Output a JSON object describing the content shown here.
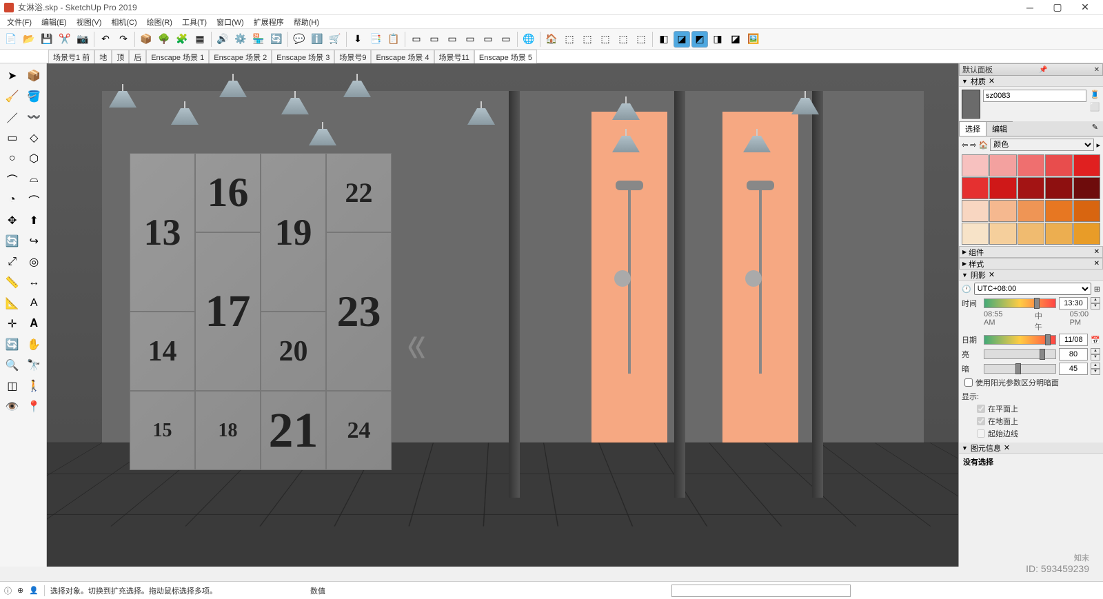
{
  "window": {
    "title": "女淋浴.skp - SketchUp Pro 2019"
  },
  "menus": [
    "文件(F)",
    "编辑(E)",
    "视图(V)",
    "相机(C)",
    "绘图(R)",
    "工具(T)",
    "窗口(W)",
    "扩展程序",
    "帮助(H)"
  ],
  "scene_tabs": [
    "场景号1 前",
    "地",
    "顶",
    "后",
    "Enscape 场景 1",
    "Enscape 场景 2",
    "Enscape 场景 3",
    "场景号9",
    "Enscape 场景 4",
    "场景号11",
    "Enscape 场景 5"
  ],
  "lockers": [
    "13",
    "16",
    "19",
    "22",
    "14",
    "17",
    "20",
    "23",
    "15",
    "18",
    "21",
    "24"
  ],
  "panel": {
    "default": "默认面板",
    "material": "材质",
    "mat_name": "sz0083",
    "select": "选择",
    "edit": "编辑",
    "color_label": "颜色",
    "palette": [
      "#f7c1bf",
      "#f3a19f",
      "#ef6f6f",
      "#e84d4d",
      "#e02020",
      "#e53030",
      "#cf1818",
      "#a31414",
      "#8e1010",
      "#6e0c0c",
      "#f8d6c1",
      "#f5b88f",
      "#ef9555",
      "#e77722",
      "#d86510",
      "#f7e3c8",
      "#f5cf9c",
      "#f0bb70",
      "#ecae50",
      "#e89c28"
    ],
    "component": "组件",
    "style": "样式",
    "shadow": "阴影",
    "tz": "UTC+08:00",
    "time_label": "时间",
    "time_start": "08:55 AM",
    "time_mid": "中午",
    "time_end": "05:00 PM",
    "time_val": "13:30",
    "date_label": "日期",
    "date_val": "11/08",
    "light": "亮",
    "light_val": "80",
    "dark": "暗",
    "dark_val": "45",
    "sun_chk": "使用阳光参数区分明暗面",
    "display": "显示:",
    "on_face": "在平面上",
    "on_ground": "在地面上",
    "edges": "起始边线",
    "entity_info": "图元信息",
    "no_sel": "没有选择"
  },
  "status": {
    "hint": "选择对象。切换到扩充选择。拖动鼠标选择多项。",
    "value_label": "数值"
  },
  "watermark": {
    "brand": "知末",
    "id": "ID: 593459239"
  }
}
